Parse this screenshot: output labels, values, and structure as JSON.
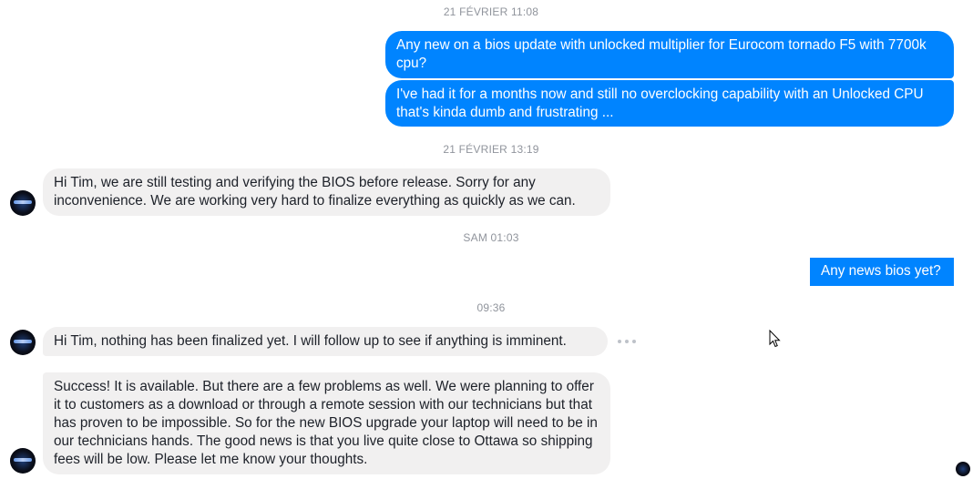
{
  "timestamps": {
    "t1": "21 FÉVRIER 11:08",
    "t2": "21 FÉVRIER 13:19",
    "t3": "SAM 01:03",
    "t4": "09:36"
  },
  "messages": [
    {
      "sender": "me",
      "text": "Any new on a bios update with unlocked multiplier for Eurocom tornado F5 with 7700k cpu?"
    },
    {
      "sender": "me",
      "text": "I've had it for a months now and still no overclocking capability with an Unlocked CPU that's kinda dumb and frustrating ..."
    },
    {
      "sender": "contact",
      "text": "Hi Tim, we are still testing and verifying the BIOS before release.  Sorry for any inconvenience.  We are working very hard to finalize everything as quickly as we can."
    },
    {
      "sender": "me",
      "text": "Any news bios yet?"
    },
    {
      "sender": "contact",
      "text": "Hi Tim, nothing has been finalized yet.  I will follow up to see if anything is imminent."
    },
    {
      "sender": "contact",
      "text": "Success!  It is available.  But there are a few problems as well.  We were planning to offer it to customers as a download or through a remote session with our technicians but that has proven to be impossible.  So for the new BIOS upgrade your laptop will need to be in our technicians hands.  The good news is that you live quite close to Ottawa so shipping fees will be low.  Please let me know your thoughts."
    }
  ],
  "colors": {
    "outgoing_bubble": "#0084ff",
    "incoming_bubble": "#f1f0f0",
    "timestamp_text": "#90949c"
  },
  "icons": {
    "message_options": "more-horizontal-icon",
    "pointer": "mouse-cursor-icon",
    "read_receipt": "seen-avatar-icon"
  }
}
